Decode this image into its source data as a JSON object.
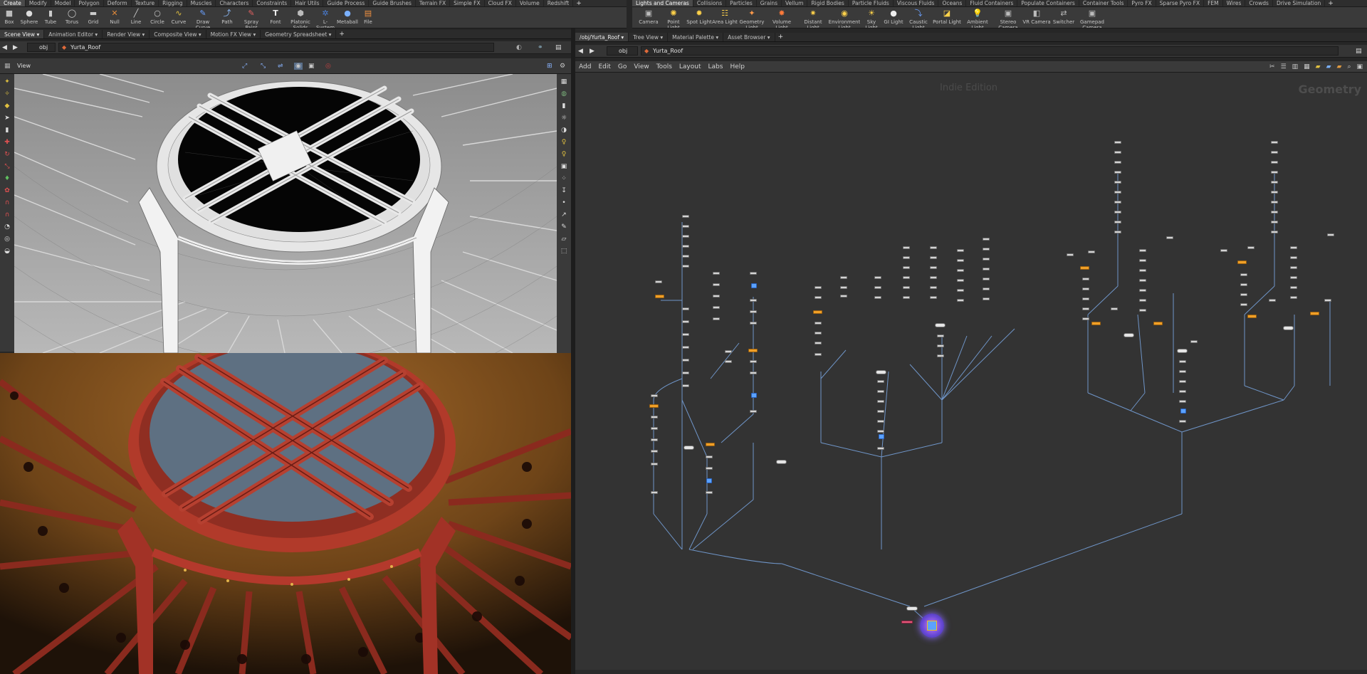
{
  "left_shelf": {
    "tabs": [
      "Create",
      "Modify",
      "Model",
      "Polygon",
      "Deform",
      "Texture",
      "Rigging",
      "Muscles",
      "Characters",
      "Constraints",
      "Hair Utils",
      "Guide Process",
      "Guide Brushes",
      "Terrain FX",
      "Simple FX",
      "Cloud FX",
      "Volume",
      "Redshift"
    ],
    "tools": [
      "Box",
      "Sphere",
      "Tube",
      "Torus",
      "Grid",
      "Null",
      "Line",
      "Circle",
      "Curve",
      "Draw Curve",
      "Path",
      "Spray Paint",
      "Font",
      "Platonic Solids",
      "L-System",
      "Metaball",
      "File"
    ]
  },
  "right_shelf": {
    "tabs": [
      "Lights and Cameras",
      "Collisions",
      "Particles",
      "Grains",
      "Vellum",
      "Rigid Bodies",
      "Particle Fluids",
      "Viscous Fluids",
      "Oceans",
      "Fluid Containers",
      "Populate Containers",
      "Container Tools",
      "Pyro FX",
      "Sparse Pyro FX",
      "FEM",
      "Wires",
      "Crowds",
      "Drive Simulation"
    ],
    "tools": [
      "Camera",
      "Point Light",
      "Spot Light",
      "Area Light",
      "Geometry Light",
      "Volume Light",
      "Distant Light",
      "Environment Light",
      "Sky Light",
      "GI Light",
      "Caustic Light",
      "Portal Light",
      "Ambient Light",
      "Stereo Camera",
      "VR Camera",
      "Switcher",
      "Gamepad Camera"
    ]
  },
  "left_pane": {
    "tabs": [
      "Scene View",
      "Animation Editor",
      "Render View",
      "Composite View",
      "Motion FX View",
      "Geometry Spreadsheet"
    ],
    "path_root": "obj",
    "path_node": "Yurta_Roof",
    "view_label": "View"
  },
  "right_pane": {
    "tabs": [
      "/obj/Yurta_Roof",
      "Tree View",
      "Material Palette",
      "Asset Browser"
    ],
    "path_root": "obj",
    "path_node": "Yurta_Roof",
    "menus": [
      "Add",
      "Edit",
      "Go",
      "View",
      "Tools",
      "Layout",
      "Labs",
      "Help"
    ],
    "watermark": "Indie Edition",
    "context_label": "Geometry"
  },
  "colors": {
    "accent_orange": "#f0a028",
    "accent_blue": "#5ba2ff",
    "wire": "#6f95c8"
  }
}
